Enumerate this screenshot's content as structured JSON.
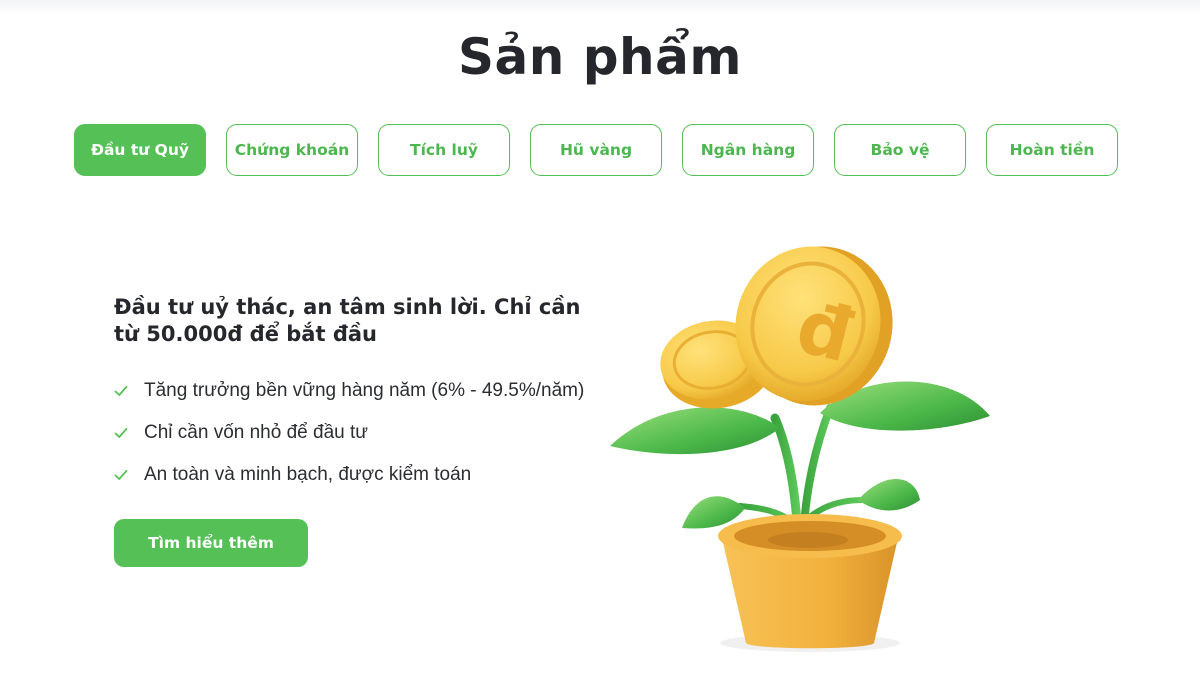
{
  "page": {
    "title": "Sản phẩm"
  },
  "tabs": [
    {
      "label": "Đầu tư Quỹ",
      "active": true
    },
    {
      "label": "Chứng khoán",
      "active": false
    },
    {
      "label": "Tích luỹ",
      "active": false
    },
    {
      "label": "Hũ vàng",
      "active": false
    },
    {
      "label": "Ngân hàng",
      "active": false
    },
    {
      "label": "Bảo vệ",
      "active": false
    },
    {
      "label": "Hoàn tiền",
      "active": false
    }
  ],
  "product": {
    "headline": "Đầu tư uỷ thác, an tâm sinh lời. Chỉ cần từ 50.000đ để bắt đầu",
    "features": [
      "Tăng trưởng bền vững hàng năm (6% - 49.5%/năm)",
      "Chỉ cần vốn nhỏ để đầu tư",
      "An toàn và minh bạch, được kiểm toán"
    ],
    "cta_label": "Tìm hiểu thêm",
    "illustration_icon": "coin-plant-illustration"
  },
  "colors": {
    "accent": "#55c056",
    "text": "#25272c",
    "coin": "#f7c948",
    "pot": "#f2b13c"
  }
}
